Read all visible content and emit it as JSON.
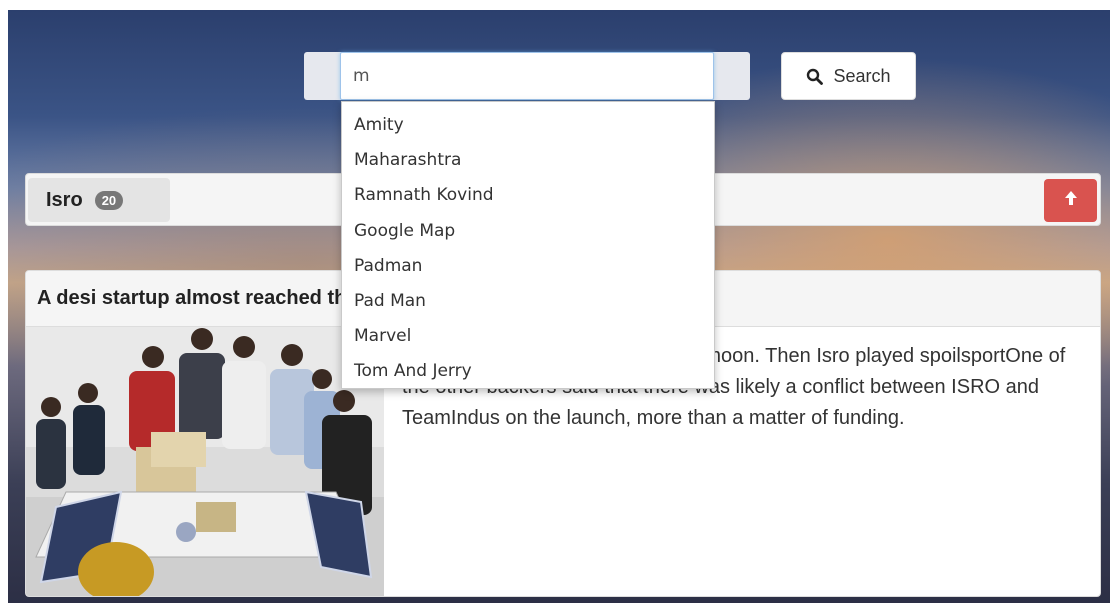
{
  "search": {
    "value": "m",
    "button_label": "Search",
    "suggestions": [
      "Amity",
      "Maharashtra",
      "Ramnath Kovind",
      "Google Map",
      "Padman",
      "Pad Man",
      "Marvel",
      "Tom And Jerry"
    ]
  },
  "topic": {
    "title": "Isro",
    "count": "20"
  },
  "article": {
    "title": "A desi startup almost reached the moon. Then Isro played spoilsport",
    "text": "A desi startup almost reached the moon. Then Isro played spoilsportOne of the other backers said that there was likely a conflict between ISRO and TeamIndus on the launch, more than a matter of funding."
  },
  "icons": {
    "search": "search-icon",
    "scroll_top": "arrow-up-icon"
  },
  "colors": {
    "danger": "#d9534f",
    "badge": "#777777"
  }
}
